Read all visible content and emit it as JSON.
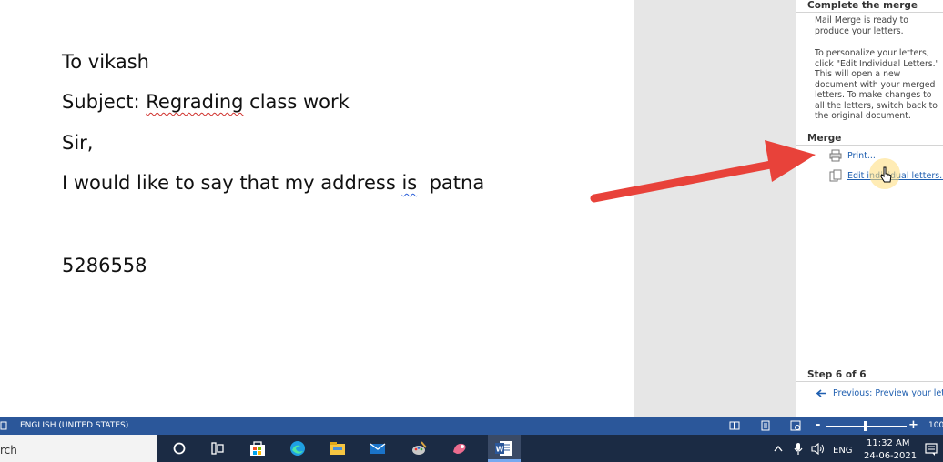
{
  "document": {
    "line1": "To vikash",
    "line2_prefix": "Subject: ",
    "line2_misspelled": "Regrading",
    "line2_suffix": " class work",
    "line3": "Sir,",
    "line4_prefix": "I would like to say that my address ",
    "line4_flagged": "is",
    "line4_suffix": "  patna",
    "line5": "5286558"
  },
  "mail_merge_pane": {
    "complete_heading": "Complete the merge",
    "ready_text": [
      "Mail Merge is ready to",
      "produce your letters."
    ],
    "personalize_text": [
      "To personalize your letters,",
      "click \"Edit Individual Letters.\"",
      "This will open a new",
      "document with your merged",
      "letters. To make changes to",
      "all the letters, switch back to",
      "the original document."
    ],
    "merge_heading": "Merge",
    "print_link": "Print...",
    "edit_link": "Edit individual letters...",
    "step_text": "Step 6 of 6",
    "previous_link": "Previous: Preview your lett"
  },
  "status_bar": {
    "language": "ENGLISH (UNITED STATES)",
    "zoom_level": "100",
    "zoom_fraction": 0.48
  },
  "taskbar": {
    "search_placeholder": "rch",
    "input_lang": "ENG",
    "time": "11:32 AM",
    "date": "24-06-2021"
  },
  "colors": {
    "accent_blue": "#2b579a",
    "link_blue": "#1f5fb0",
    "arrow_red": "#e8423a",
    "taskbar_bg": "#1b2b44"
  }
}
